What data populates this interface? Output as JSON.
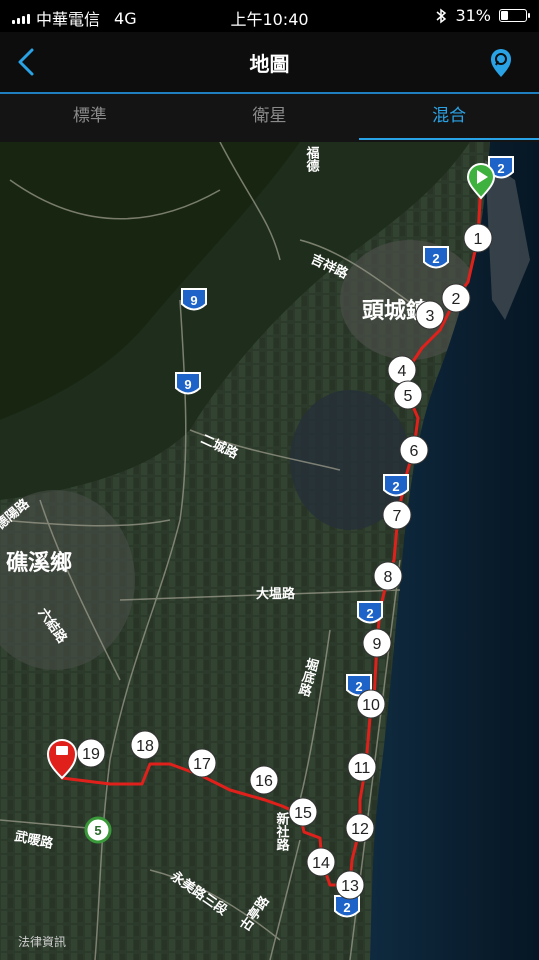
{
  "status": {
    "carrier": "中華電信",
    "network": "4G",
    "time": "上午10:40",
    "battery": "31%",
    "battery_level": 0.31
  },
  "nav": {
    "title": "地圖",
    "back_icon": "chevron-left-icon",
    "pin_icon": "map-pin-icon"
  },
  "tabs": [
    {
      "label": "標準"
    },
    {
      "label": "衛星"
    },
    {
      "label": "混合"
    }
  ],
  "active_tab": 2,
  "colors": {
    "accent": "#2aa3e6",
    "route": "#e0201b",
    "start": "#3fb13f",
    "end": "#e0201b"
  },
  "map": {
    "labels": [
      "福德",
      "吉祥路",
      "頭城鎮",
      "二城路",
      "德陽路",
      "礁溪鄉",
      "六結路",
      "大塭路",
      "堀底路",
      "新社路",
      "武暖路",
      "永美路三段",
      "古亭路"
    ],
    "route_shields": [
      "2",
      "2",
      "2",
      "2",
      "2",
      "2",
      "9",
      "9",
      "5"
    ],
    "laps": [
      "1",
      "2",
      "3",
      "4",
      "5",
      "6",
      "7",
      "8",
      "9",
      "10",
      "11",
      "12",
      "13",
      "14",
      "15",
      "16",
      "17",
      "18",
      "19"
    ],
    "watermark": "法律資訊"
  }
}
